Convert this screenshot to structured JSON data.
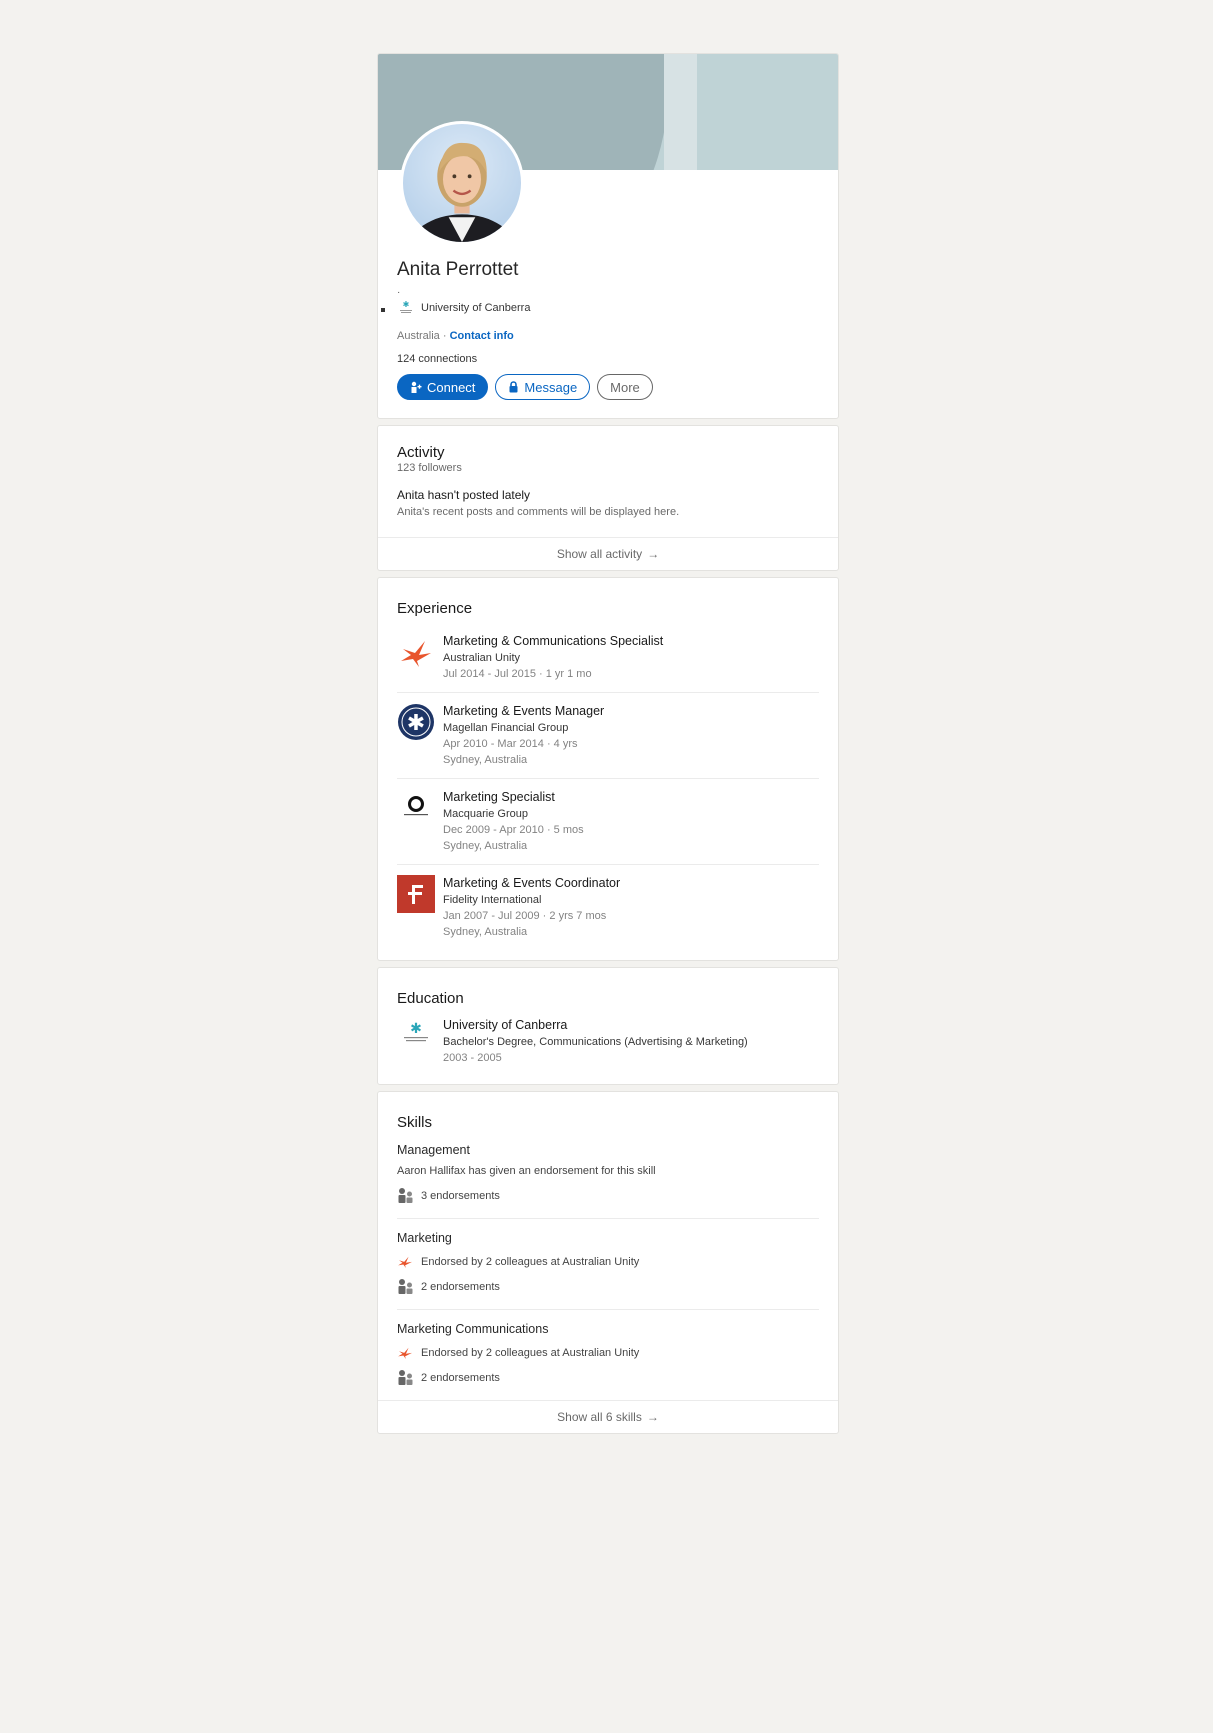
{
  "profile": {
    "name": "Anita Perrottet",
    "headline_dot": "·",
    "school": "University of Canberra",
    "location": "Australia",
    "location_sep": " · ",
    "contact_link": "Contact info",
    "connections": "124 connections",
    "buttons": {
      "connect": "Connect",
      "message": "Message",
      "more": "More"
    }
  },
  "activity": {
    "title": "Activity",
    "followers": "123 followers",
    "empty_title": "Anita hasn't posted lately",
    "empty_text": "Anita's recent posts and comments will be displayed here.",
    "show_all": "Show all activity"
  },
  "experience": {
    "title": "Experience",
    "items": [
      {
        "title": "Marketing & Communications Specialist",
        "company": "Australian Unity",
        "dates": "Jul 2014 - Jul 2015 · 1 yr 1 mo",
        "location": ""
      },
      {
        "title": "Marketing & Events Manager",
        "company": "Magellan Financial Group",
        "dates": "Apr 2010 - Mar 2014 · 4 yrs",
        "location": "Sydney, Australia"
      },
      {
        "title": "Marketing Specialist",
        "company": "Macquarie Group",
        "dates": "Dec 2009 - Apr 2010 · 5 mos",
        "location": "Sydney, Australia"
      },
      {
        "title": "Marketing & Events Coordinator",
        "company": "Fidelity International",
        "dates": "Jan 2007 - Jul 2009 · 2 yrs 7 mos",
        "location": "Sydney, Australia"
      }
    ]
  },
  "education": {
    "title": "Education",
    "school": "University of Canberra",
    "degree": "Bachelor's Degree, Communications (Advertising & Marketing)",
    "years": "2003 - 2005"
  },
  "skills": {
    "title": "Skills",
    "items": [
      {
        "name": "Management",
        "detail": "Aaron Hallifax has given an endorsement for this skill",
        "endorsements": "3 endorsements"
      },
      {
        "name": "Marketing",
        "detail": "Endorsed by 2 colleagues at Australian Unity",
        "endorsements": "2 endorsements"
      },
      {
        "name": "Marketing Communications",
        "detail": "Endorsed by 2 colleagues at Australian Unity",
        "endorsements": "2 endorsements"
      }
    ],
    "show_all": "Show all 6 skills"
  },
  "icons": [
    "connect-icon",
    "lock-icon",
    "arrow-right-icon",
    "people-icon",
    "australian-unity-logo",
    "magellan-logo",
    "macquarie-logo",
    "fidelity-logo",
    "uc-logo"
  ],
  "colors": {
    "accent": "#0a66c2",
    "page_bg": "#f3f2ef",
    "fidelity_red": "#c0392b",
    "unity_orange": "#e8552d",
    "magellan_navy": "#1e3566"
  }
}
